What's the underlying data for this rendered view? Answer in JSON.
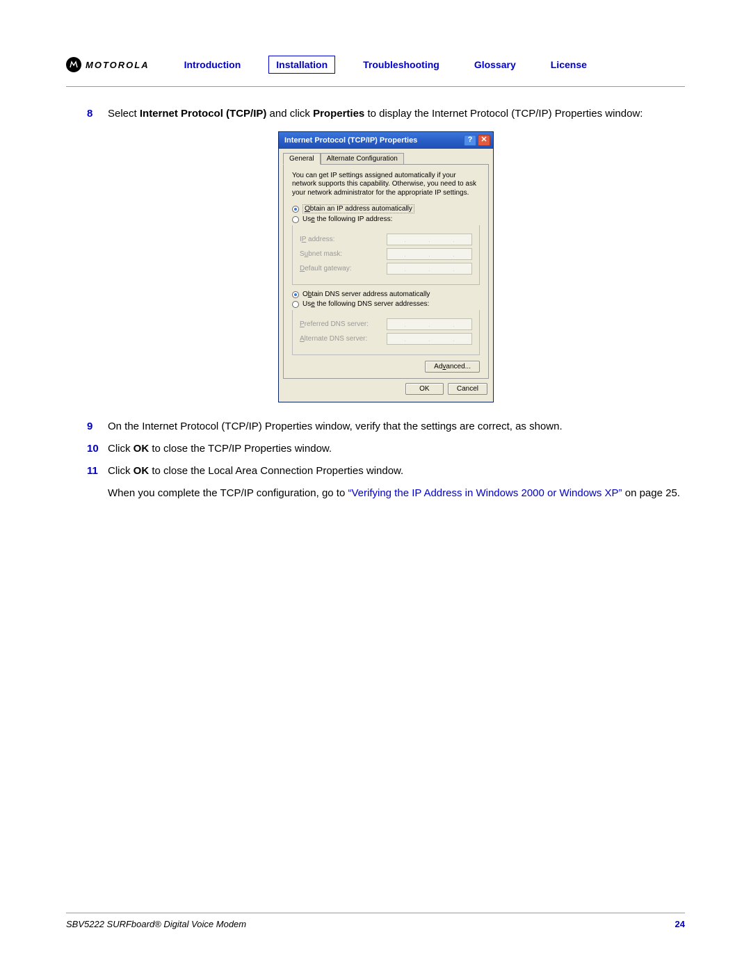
{
  "header": {
    "brand": "MOTOROLA",
    "nav": {
      "introduction": "Introduction",
      "installation": "Installation",
      "troubleshooting": "Troubleshooting",
      "glossary": "Glossary",
      "license": "License"
    }
  },
  "steps": {
    "s8": {
      "num": "8",
      "pre": "Select ",
      "bold1": "Internet Protocol (TCP/IP)",
      "mid1": " and click ",
      "bold2": "Properties",
      "post": " to display the Internet Protocol (TCP/IP) Properties window:"
    },
    "s9": {
      "num": "9",
      "text": "On the Internet Protocol (TCP/IP) Properties window, verify that the settings are correct, as shown."
    },
    "s10": {
      "num": "10",
      "pre": "Click ",
      "bold": "OK",
      "post": " to close the TCP/IP Properties window."
    },
    "s11": {
      "num": "11",
      "pre": "Click ",
      "bold": "OK",
      "post": " to close the Local Area Connection Properties window."
    },
    "final": {
      "pre": "When you complete the TCP/IP configuration, go to ",
      "link": "“Verifying the IP Address in Windows 2000 or Windows XP”",
      "post": " on page 25."
    }
  },
  "dialog": {
    "title": "Internet Protocol (TCP/IP) Properties",
    "tabs": {
      "general": "General",
      "alt": "Alternate Configuration"
    },
    "desc": "You can get IP settings assigned automatically if your network supports this capability. Otherwise, you need to ask your network administrator for the appropriate IP settings.",
    "radio_ip_auto_pre": "O",
    "radio_ip_auto_rest": "btain an IP address automatically",
    "radio_ip_use_pre": "Us",
    "radio_ip_use_u": "e",
    "radio_ip_use_rest": " the following IP address:",
    "ip_label_pre": "I",
    "ip_label_u": "P",
    "ip_label_rest": " address:",
    "subnet_pre": "S",
    "subnet_u": "u",
    "subnet_rest": "bnet mask:",
    "gateway_pre": "",
    "gateway_u": "D",
    "gateway_rest": "efault gateway:",
    "radio_dns_auto_pre": "O",
    "radio_dns_auto_u": "b",
    "radio_dns_auto_rest": "tain DNS server address automatically",
    "radio_dns_use_pre": "Us",
    "radio_dns_use_u": "e",
    "radio_dns_use_rest": " the following DNS server addresses:",
    "pref_dns_pre": "",
    "pref_dns_u": "P",
    "pref_dns_rest": "referred DNS server:",
    "alt_dns_pre": "",
    "alt_dns_u": "A",
    "alt_dns_rest": "lternate DNS server:",
    "advanced_pre": "Ad",
    "advanced_u": "v",
    "advanced_rest": "anced...",
    "ok": "OK",
    "cancel": "Cancel"
  },
  "footer": {
    "left": "SBV5222 SURFboard® Digital Voice Modem",
    "page": "24"
  }
}
